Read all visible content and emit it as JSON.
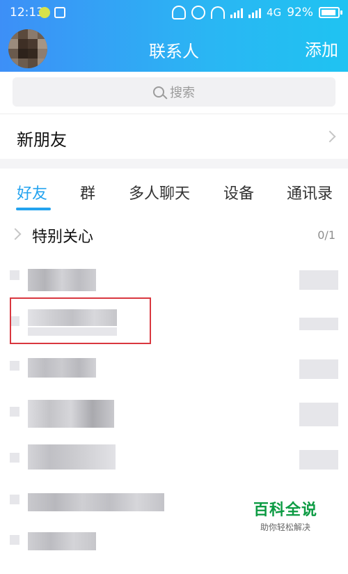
{
  "status_bar": {
    "time": "12:13",
    "network": "4G",
    "battery": "92%",
    "battery_level": 0.92,
    "icons": [
      "app-notification-icon",
      "qr-scan-icon",
      "mute-bell-icon",
      "alarm-icon",
      "wifi-icon",
      "signal-icon",
      "battery-icon"
    ]
  },
  "header": {
    "title": "联系人",
    "add_label": "添加"
  },
  "search": {
    "placeholder": "搜索"
  },
  "new_friends": {
    "label": "新朋友"
  },
  "tabs": [
    {
      "label": "好友",
      "active": true
    },
    {
      "label": "群",
      "active": false
    },
    {
      "label": "多人聊天",
      "active": false
    },
    {
      "label": "设备",
      "active": false
    },
    {
      "label": "通讯录",
      "active": false
    }
  ],
  "special_group": {
    "label": "特别关心",
    "count": "0/1"
  },
  "watermark": {
    "brand": "百科全说",
    "tagline": "助你轻松解决"
  },
  "colors": {
    "header_start": "#3d8ff7",
    "header_end": "#1fc3f2",
    "accent": "#23a3ef",
    "highlight_box": "#d9373f",
    "watermark_green": "#0c9b43"
  }
}
